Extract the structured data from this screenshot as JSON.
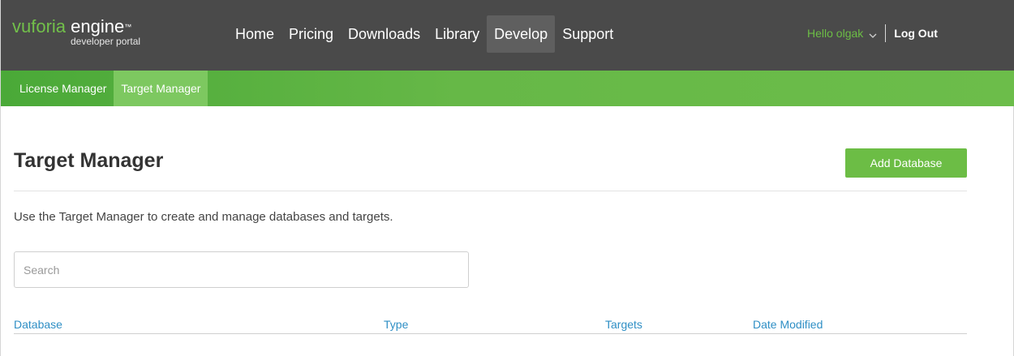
{
  "header": {
    "logo": {
      "brand_part1": "vuforia",
      "brand_part2": " engine",
      "trademark": "™",
      "subtitle": "developer portal"
    },
    "nav": [
      {
        "label": "Home",
        "active": false
      },
      {
        "label": "Pricing",
        "active": false
      },
      {
        "label": "Downloads",
        "active": false
      },
      {
        "label": "Library",
        "active": false
      },
      {
        "label": "Develop",
        "active": true
      },
      {
        "label": "Support",
        "active": false
      }
    ],
    "user": {
      "greeting": "Hello olgak",
      "logout_label": "Log Out"
    }
  },
  "subnav": [
    {
      "label": "License Manager",
      "active": false
    },
    {
      "label": "Target Manager",
      "active": true
    }
  ],
  "main": {
    "title": "Target Manager",
    "add_button_label": "Add Database",
    "intro": "Use the Target Manager to create and manage databases and targets.",
    "search": {
      "placeholder": "Search",
      "value": ""
    },
    "table": {
      "headers": [
        "Database",
        "Type",
        "Targets",
        "Date Modified"
      ],
      "rows": []
    }
  },
  "colors": {
    "topbar_bg": "#4a4a4a",
    "brand_green": "#72c04a",
    "subbar_green": "#66b847",
    "button_green": "#6cbd45",
    "link_blue": "#2f8fc5"
  }
}
